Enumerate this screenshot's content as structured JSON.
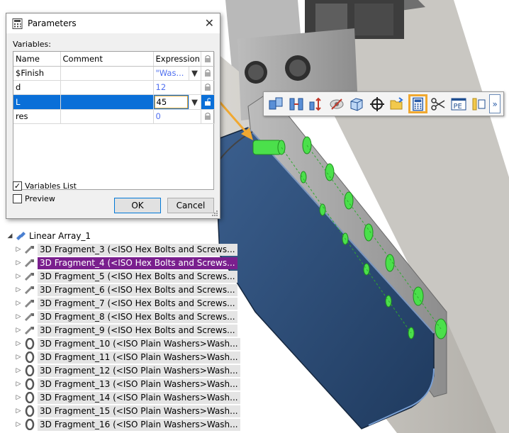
{
  "dialog": {
    "title": "Parameters",
    "close_glyph": "✕",
    "variables_label": "Variables:",
    "columns": {
      "name": "Name",
      "comment": "Comment",
      "expression": "Expression"
    },
    "rows": [
      {
        "name": "$Finish",
        "comment": "",
        "expression": "\"Was..."
      },
      {
        "name": "d",
        "comment": "",
        "expression": "12"
      },
      {
        "name": "L",
        "comment": "",
        "expression": "45"
      },
      {
        "name": "res",
        "comment": "",
        "expression": "0"
      }
    ],
    "variables_list_label": "Variables List",
    "variables_list_checked": true,
    "preview_label": "Preview",
    "preview_checked": false,
    "ok_label": "OK",
    "cancel_label": "Cancel"
  },
  "toolbar": {
    "buttons": [
      "copy-parts-icon",
      "align-icon",
      "move-arrows-icon",
      "hide-icon",
      "box-icon",
      "crosshair-icon",
      "open-folder-icon",
      "parameters-calculator-icon",
      "scissors-icon",
      "pe-icon",
      "ruler-icon"
    ],
    "active": "parameters-calculator-icon",
    "more_glyph": "»"
  },
  "tree": {
    "root": {
      "label": "Linear Array_1",
      "expanded": true
    },
    "items": [
      {
        "label": "3D Fragment_3 (<ISO Hex Bolts and Screws...",
        "icon": "bolt-icon"
      },
      {
        "label": "3D Fragment_4 (<ISO Hex Bolts and Screws...",
        "icon": "bolt-icon",
        "selected": true
      },
      {
        "label": "3D Fragment_5 (<ISO Hex Bolts and Screws...",
        "icon": "bolt-icon"
      },
      {
        "label": "3D Fragment_6 (<ISO Hex Bolts and Screws...",
        "icon": "bolt-icon"
      },
      {
        "label": "3D Fragment_7 (<ISO Hex Bolts and Screws...",
        "icon": "bolt-icon"
      },
      {
        "label": "3D Fragment_8 (<ISO Hex Bolts and Screws...",
        "icon": "bolt-icon"
      },
      {
        "label": "3D Fragment_9 (<ISO Hex Bolts and Screws...",
        "icon": "bolt-icon"
      },
      {
        "label": "3D Fragment_10 (<ISO Plain Washers>Wash...",
        "icon": "washer-icon"
      },
      {
        "label": "3D Fragment_11 (<ISO Plain Washers>Wash...",
        "icon": "washer-icon"
      },
      {
        "label": "3D Fragment_12 (<ISO Plain Washers>Wash...",
        "icon": "washer-icon"
      },
      {
        "label": "3D Fragment_13 (<ISO Plain Washers>Wash...",
        "icon": "washer-icon"
      },
      {
        "label": "3D Fragment_14 (<ISO Plain Washers>Wash...",
        "icon": "washer-icon"
      },
      {
        "label": "3D Fragment_15 (<ISO Plain Washers>Wash...",
        "icon": "washer-icon"
      },
      {
        "label": "3D Fragment_16 (<ISO Plain Washers>Wash...",
        "icon": "washer-icon"
      }
    ]
  },
  "colors": {
    "selection_row": "#0a6fd8",
    "tree_selection": "#7a1f8e",
    "highlight_orange": "#f0a830",
    "bolt_green": "#4be04b",
    "plate_blue": "#2e4f79"
  }
}
